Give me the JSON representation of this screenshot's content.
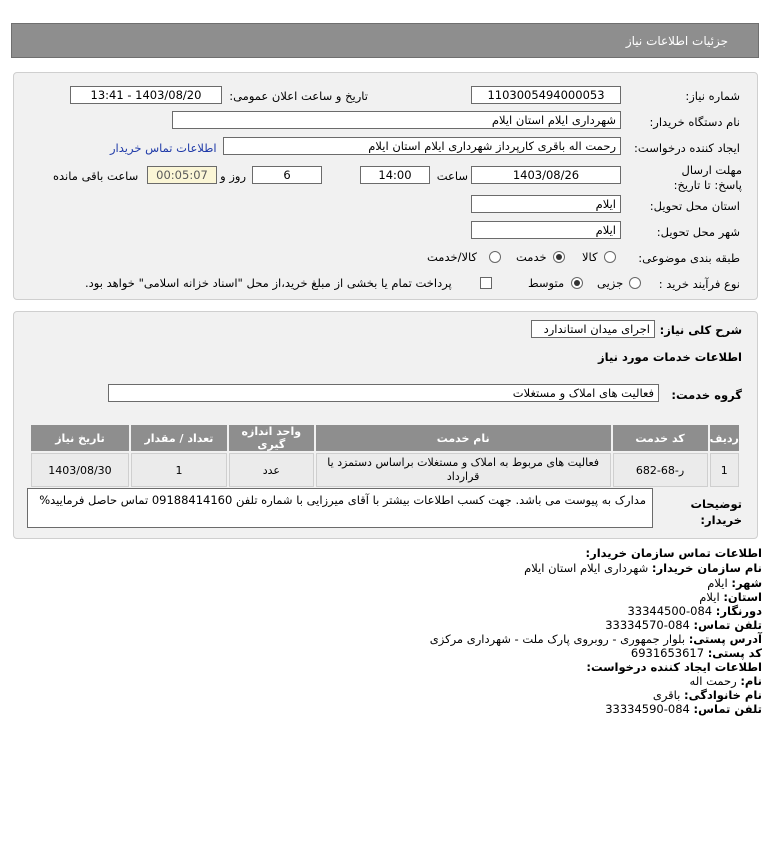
{
  "header": {
    "title": "جزئیات اطلاعات نیاز"
  },
  "info": {
    "need_number_label": "شماره نیاز:",
    "need_number": "1103005494000053",
    "announce_label": "تاریخ و ساعت اعلان عمومی:",
    "announce_value": "1403/08/20 - 13:41",
    "buyer_org_label": "نام دستگاه خریدار:",
    "buyer_org": "شهرداری ایلام استان ایلام",
    "requester_label": "ایجاد کننده درخواست:",
    "requester": "رحمت اله باقری کارپرداز شهرداری ایلام استان ایلام",
    "buyer_contact_link": "اطلاعات تماس خریدار",
    "deadline_label": "مهلت ارسال پاسخ: تا تاریخ:",
    "deadline_date": "1403/08/26",
    "time_label": "ساعت",
    "deadline_time": "14:00",
    "days_value": "6",
    "days_label": "روز و",
    "remaining_time": "00:05:07",
    "remaining_label": "ساعت باقی مانده",
    "province_label": "استان محل تحویل:",
    "province": "ایلام",
    "city_label": "شهر محل تحویل:",
    "city": "ایلام",
    "category_label": "طبقه بندی موضوعی:",
    "category_options": [
      "کالا",
      "خدمت",
      "کالا/خدمت"
    ],
    "category_selected": "خدمت",
    "process_label": "نوع فرآیند خرید :",
    "process_options": [
      "جزیی",
      "متوسط"
    ],
    "process_selected": "متوسط",
    "treasury_text": "پرداخت تمام یا بخشی از مبلغ خرید،از محل \"اسناد خزانه اسلامی\" خواهد بود."
  },
  "details": {
    "summary_label": "شرح کلی نیاز:",
    "summary": "اجرای میدان استاندارد",
    "services_heading": "اطلاعات خدمات مورد نیاز",
    "service_group_label": "گروه خدمت:",
    "service_group": "فعالیت های  املاک و مستغلات",
    "table": {
      "headers": [
        "ردیف",
        "کد خدمت",
        "نام خدمت",
        "واحد اندازه گیری",
        "تعداد / مقدار",
        "تاریخ نیاز"
      ],
      "rows": [
        [
          "1",
          "ر-68-682",
          "فعالیت های مربوط به املاک و مستغلات براساس دستمزد یا قرارداد",
          "عدد",
          "1",
          "1403/08/30"
        ]
      ]
    },
    "buyer_notes_label": "توضیحات خریدار:",
    "buyer_notes": "مدارک به پیوست می باشد. جهت کسب اطلاعات بیشتر با آقای میرزایی با شماره تلفن 09188414160 تماس حاصل فرمایید%"
  },
  "contact": {
    "heading": "اطلاعات تماس سازمان خریدار:",
    "org_label": "نام سازمان خریدار:",
    "org": "شهرداری ایلام استان ایلام",
    "city_label": "شهر:",
    "city": "ایلام",
    "province_label": "استان:",
    "province": "ایلام",
    "fax_label": "دورنگار:",
    "fax": "084-33344500",
    "phone_label": "تلفن تماس:",
    "phone": "084-33334570",
    "address_label": "آدرس پستی:",
    "address": "بلوار جمهوری - روبروی پارک ملت - شهرداری مرکزی",
    "postal_label": "کد پستی:",
    "postal": "6931653617",
    "creator_heading": "اطلاعات ایجاد کننده درخواست:",
    "first_name_label": "نام:",
    "first_name": "رحمت اله",
    "last_name_label": "نام خانوادگی:",
    "last_name": "باقری",
    "creator_phone_label": "تلفن تماس:",
    "creator_phone": "084-33334590"
  },
  "colors": {
    "header_bg": "#8e8e8e",
    "panel_bg": "#f1f1f1",
    "link": "#1f3aa8",
    "timer_bg": "#fbf6d6"
  }
}
